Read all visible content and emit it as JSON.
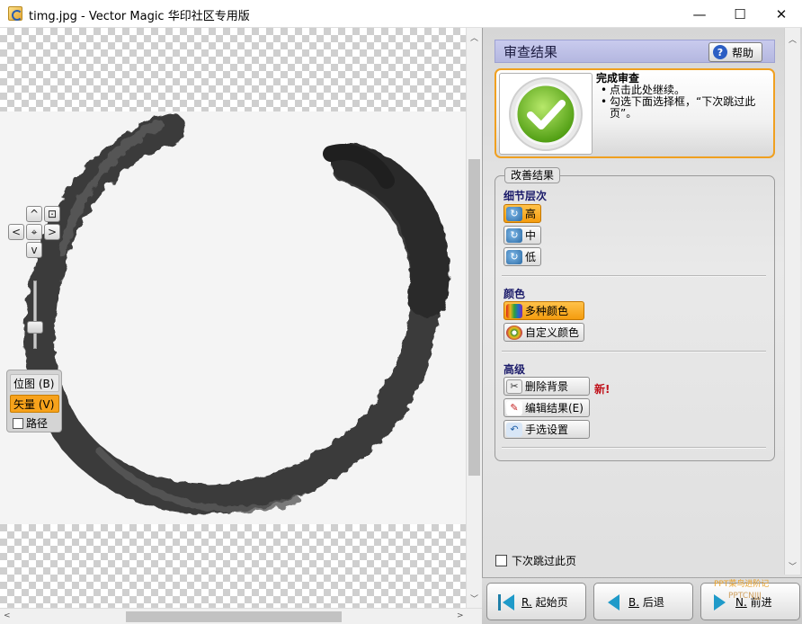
{
  "window": {
    "title": "timg.jpg - Vector Magic 华印社区专用版",
    "minimize_glyph": "—",
    "maximize_glyph": "☐",
    "close_glyph": "✕"
  },
  "canvas": {
    "nav": {
      "up": "^",
      "down": "v",
      "left": "<",
      "right": ">",
      "center": "⌖",
      "fit": "⊡"
    },
    "modes": {
      "bitmap": "位图 (B)",
      "vector": "矢量 (V)",
      "path": "路径"
    }
  },
  "panel": {
    "title": "审查结果",
    "help_label": "帮助",
    "review": {
      "title": "完成审查",
      "bullet1": "点击此处继续。",
      "bullet2_line1": "勾选下面选择框，“下次跳过此",
      "bullet2_line2": "页”。"
    },
    "improve_group": {
      "legend": "改善结果",
      "detail": {
        "title": "细节层次",
        "high": "高",
        "medium": "中",
        "low": "低",
        "selected": "高"
      },
      "color": {
        "title": "颜色",
        "multi": "多种颜色",
        "custom": "自定义颜色",
        "selected": "多种颜色"
      },
      "advanced": {
        "title": "高级",
        "delete_bg": "删除背景",
        "new_badge": "新!",
        "edit_result": "编辑结果(E)",
        "manual_settings": "手选设置"
      }
    },
    "skip_label": "下次跳过此页",
    "skip_checked": false
  },
  "bottom": {
    "start_key": "R.",
    "start_label": "起始页",
    "back_key": "B.",
    "back_label": "后退",
    "next_key": "N.",
    "next_label": "前进"
  },
  "watermark": {
    "line1": "PPT菜鸟进阶记",
    "line2": "PPTCNJJJ"
  },
  "colors": {
    "accent": "#f49c0f",
    "header": "#b4b7e0",
    "new_badge": "#c0121b"
  }
}
